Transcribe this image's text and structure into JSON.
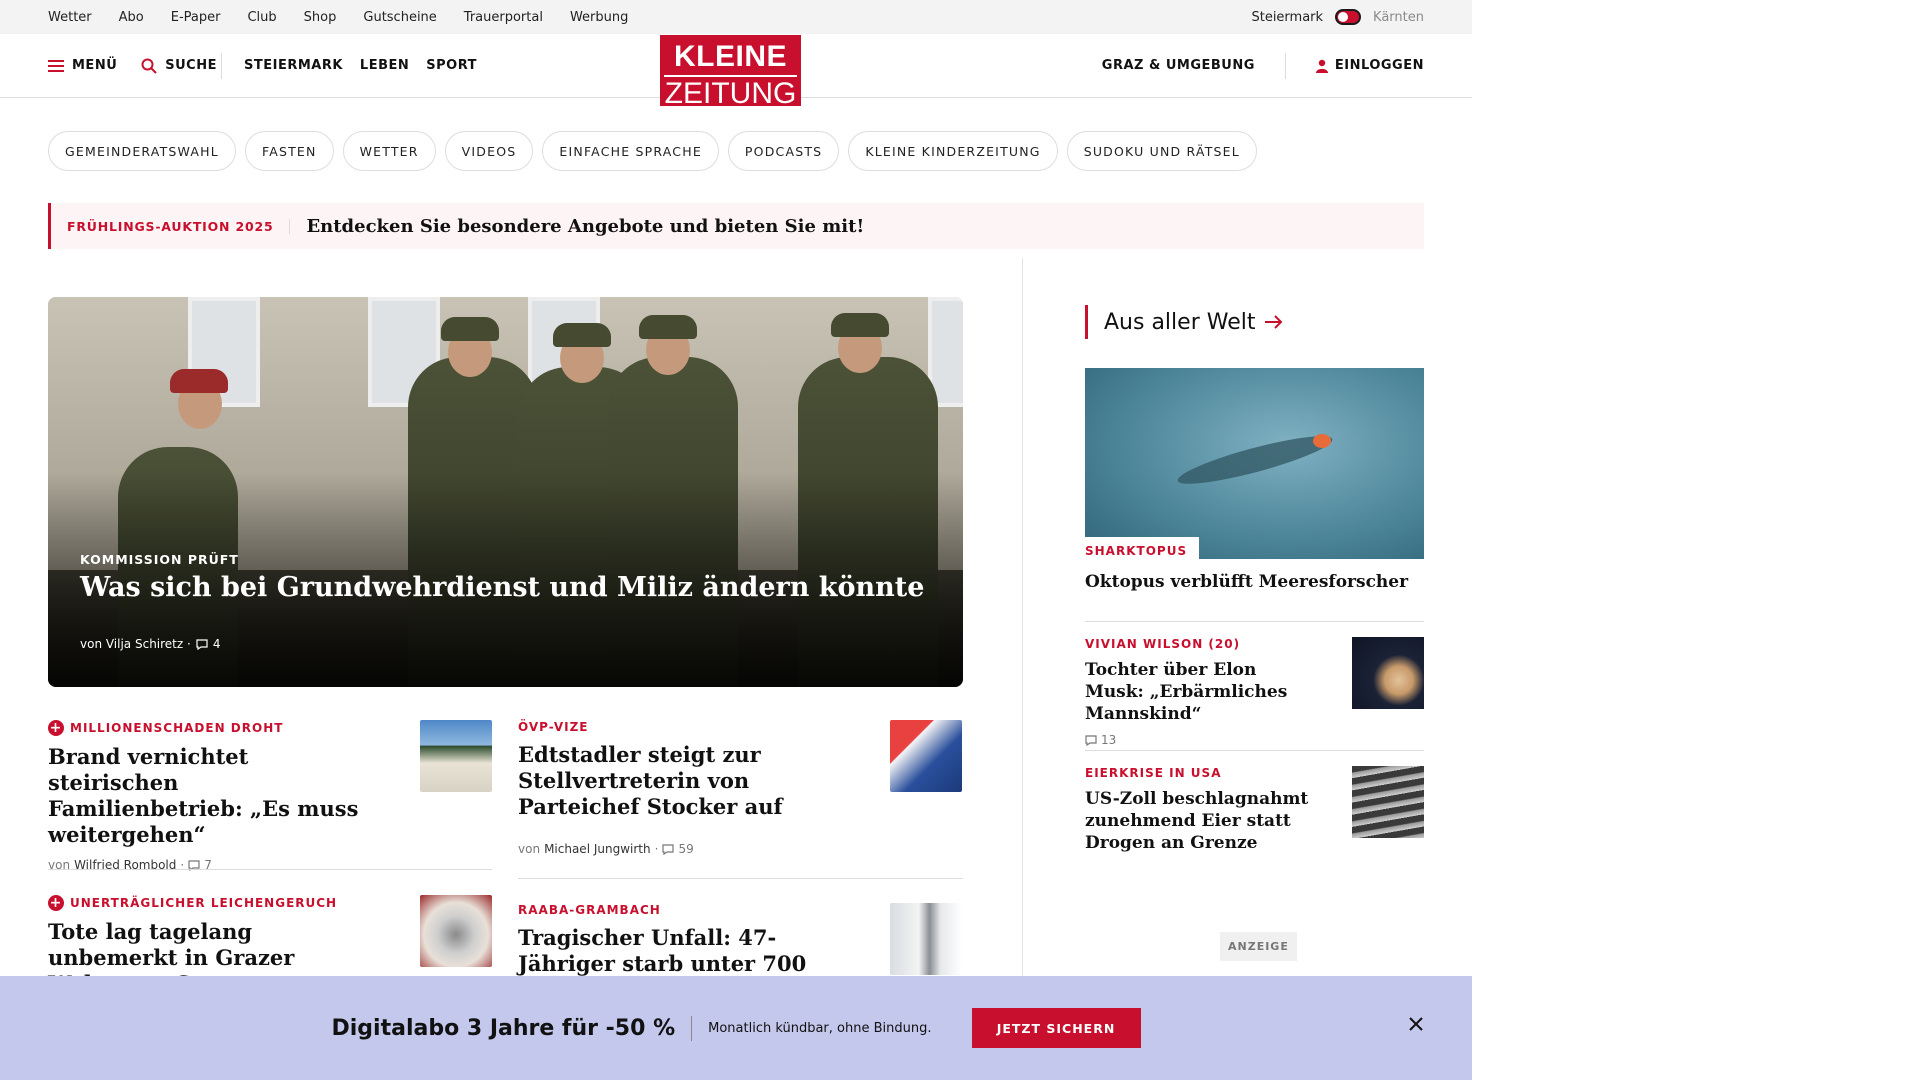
{
  "util": {
    "links": [
      "Wetter",
      "Abo",
      "E-Paper",
      "Club",
      "Shop",
      "Gutscheine",
      "Trauerportal",
      "Werbung"
    ],
    "region_active": "Steiermark",
    "region_inactive": "Kärnten"
  },
  "header": {
    "menu_label": "MENÜ",
    "search_label": "SUCHE",
    "nav": [
      "STEIERMARK",
      "LEBEN",
      "SPORT"
    ],
    "logo_line1": "KLEINE",
    "logo_line2": "ZEITUNG",
    "region_label": "GRAZ & UMGEBUNG",
    "login_label": "EINLOGGEN"
  },
  "pills": [
    "GEMEINDERATSWAHL",
    "FASTEN",
    "WETTER",
    "VIDEOS",
    "EINFACHE SPRACHE",
    "PODCASTS",
    "KLEINE KINDERZEITUNG",
    "SUDOKU UND RÄTSEL"
  ],
  "promo": {
    "tag": "FRÜHLINGS-AUKTION 2025",
    "text": "Entdecken Sie besondere Angebote und bieten Sie mit!"
  },
  "hero": {
    "kicker": "KOMMISSION PRÜFT",
    "title": "Was sich bei Grundwehrdienst und Miliz ändern könnte",
    "author_prefix": "von Vilja Schiretz ·",
    "comments": "4"
  },
  "articles": [
    {
      "kicker": "MILLIONENSCHADEN DROHT",
      "title": "Brand vernichtet steirischen Familienbetrieb: „Es muss weitergehen“",
      "author_prefix": "von",
      "author": "Wilfried Rombold",
      "comments": "7"
    },
    {
      "kicker": "ÖVP-VIZE",
      "title": "Edtstadler steigt zur Stellvertreterin von Parteichef Stocker auf",
      "author_prefix": "von",
      "author": "Michael Jungwirth",
      "comments": "59"
    },
    {
      "kicker": "UNERTRÄGLICHER LEICHENGERUCH",
      "title": "Tote lag tagelang unbemerkt in Grazer Wohnung, Gesetz"
    },
    {
      "kicker": "RAABA-GRAMBACH",
      "title": "Tragischer Unfall: 47-Jähriger starb unter 700"
    }
  ],
  "sidebar": {
    "section_title": "Aus aller Welt",
    "top_kicker": "SHARKTOPUS",
    "top_title": "Oktopus verblüfft Meeresforscher",
    "items": [
      {
        "kicker": "VIVIAN WILSON (20)",
        "title": "Tochter über Elon Musk: „Erbärmliches Mannskind“",
        "comments": "13"
      },
      {
        "kicker": "EIERKRISE IN USA",
        "title": "US-Zoll beschlagnahmt zunehmend Eier statt Drogen an Grenze"
      }
    ],
    "ad_label": "ANZEIGE"
  },
  "banner": {
    "title": "Digitalabo 3 Jahre für -50 %",
    "subtitle": "Monatlich kündbar, ohne Bindung.",
    "button": "JETZT SICHERN"
  },
  "colors": {
    "brand": "#c8102e",
    "banner_bg": "#c4c8ec"
  }
}
